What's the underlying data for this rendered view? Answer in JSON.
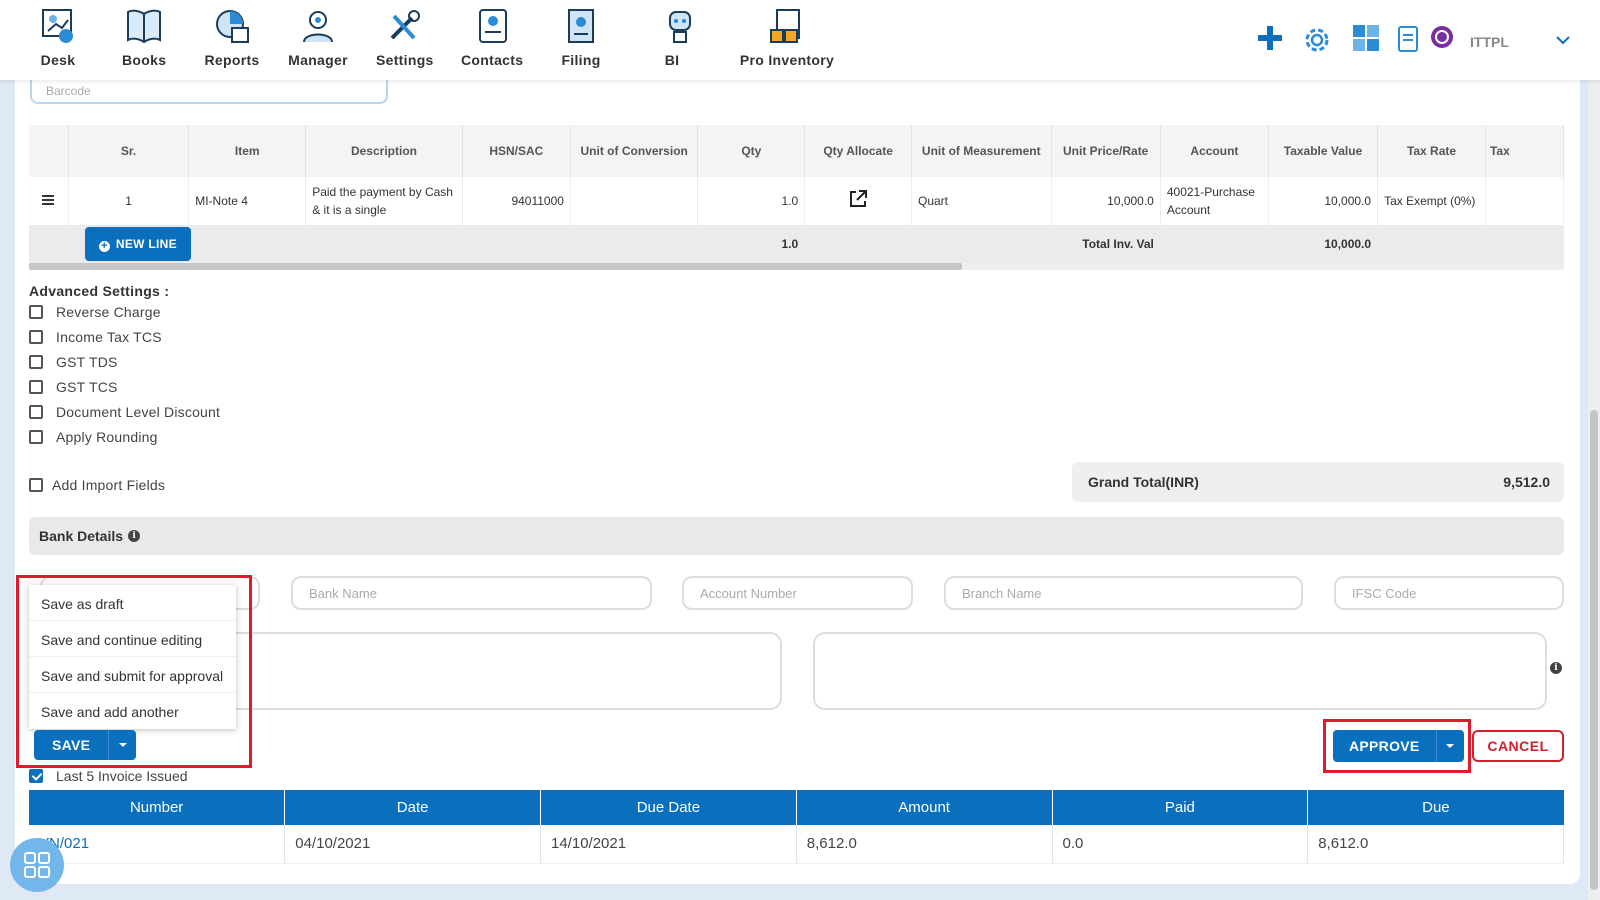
{
  "nav": {
    "items": [
      {
        "label": "Desk",
        "icon": "desk-icon"
      },
      {
        "label": "Books",
        "icon": "books-icon"
      },
      {
        "label": "Reports",
        "icon": "reports-icon"
      },
      {
        "label": "Manager",
        "icon": "manager-icon"
      },
      {
        "label": "Settings",
        "icon": "settings-icon"
      },
      {
        "label": "Contacts",
        "icon": "contacts-icon"
      },
      {
        "label": "Filing",
        "icon": "filing-icon"
      },
      {
        "label": "BI",
        "icon": "bi-icon"
      },
      {
        "label": "Pro Inventory",
        "icon": "pro-inventory-icon"
      }
    ],
    "org_name": "ITTPL"
  },
  "barcode": {
    "placeholder": "Barcode"
  },
  "grid": {
    "headers": [
      "Sr.",
      "Item",
      "Description",
      "HSN/SAC",
      "Unit of Conversion",
      "Qty",
      "Qty Allocate",
      "Unit of Measurement",
      "Unit Price/Rate",
      "Account",
      "Taxable Value",
      "Tax Rate",
      "Tax"
    ],
    "row": {
      "sr": "1",
      "item": "MI-Note 4",
      "description": "Paid the payment by Cash & it is a single",
      "hsn": "94011000",
      "unit_conversion": "",
      "qty": "1.0",
      "uom": "Quart",
      "unit_price": "10,000.0",
      "account": "40021-Purchase Account",
      "taxable_value": "10,000.0",
      "tax_rate": "Tax Exempt (0%)"
    },
    "total": {
      "new_line_label": "NEW LINE",
      "qty_total": "1.0",
      "label": "Total Inv. Val",
      "value": "10,000.0"
    }
  },
  "advanced": {
    "title": "Advanced Settings :",
    "options": [
      "Reverse Charge",
      "Income Tax TCS",
      "GST TDS",
      "GST TCS",
      "Document Level Discount",
      "Apply Rounding"
    ],
    "import_fields": "Add Import Fields"
  },
  "grand_total": {
    "label": "Grand Total(INR)",
    "value": "9,512.0"
  },
  "bank": {
    "title": "Bank Details",
    "fields": {
      "bank_name": "Bank Name",
      "account_number": "Account Number",
      "branch_name": "Branch Name",
      "ifsc": "IFSC Code"
    }
  },
  "save_menu": {
    "options": [
      "Save as draft",
      "Save and continue editing",
      "Save and submit for approval",
      "Save and add another"
    ],
    "save_label": "SAVE"
  },
  "actions": {
    "approve_label": "APPROVE",
    "cancel_label": "CANCEL"
  },
  "last_invoices": {
    "label": "Last 5 Invoice Issued",
    "headers": [
      "Number",
      "Date",
      "Due Date",
      "Amount",
      "Paid",
      "Due"
    ],
    "rows": [
      {
        "number": "VN/021",
        "date": "04/10/2021",
        "due_date": "14/10/2021",
        "amount": "8,612.0",
        "paid": "0.0",
        "due": "8,612.0"
      }
    ]
  },
  "colors": {
    "accent": "#0a6fbc",
    "highlight": "#e01a2b",
    "cancel": "#d0202a"
  }
}
